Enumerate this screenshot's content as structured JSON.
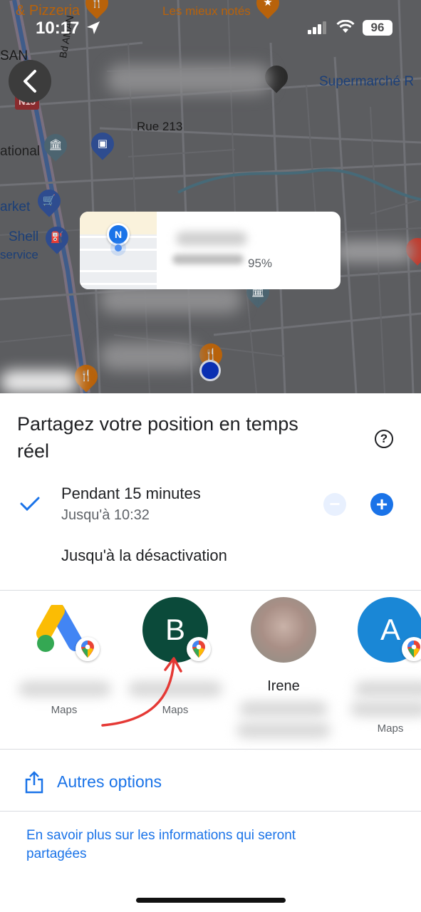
{
  "status_bar": {
    "time": "10:17",
    "battery": "96"
  },
  "map": {
    "labels": {
      "pizzeria": "& Pizzeria",
      "mieux_notes": "Les mieux notés",
      "san": "SAN",
      "bd_aman": "Bd AMAN",
      "n15": "N15",
      "supermarche": "Supermarché R",
      "rue_213": "Rue 213",
      "national": "ational",
      "market": "arket",
      "shell": "Shell",
      "service": "service"
    },
    "info_card": {
      "initial": "N",
      "battery_text": "95%"
    },
    "overlay_color": "#5c5d60",
    "user_dot_color": "#0a2fb2"
  },
  "sheet": {
    "title": "Partagez votre position en temps réel",
    "help_icon": "?",
    "duration_option": {
      "label": "Pendant 15 minutes",
      "sub": "Jusqu'à 10:32",
      "minus": "−",
      "plus": "+"
    },
    "until_off_option": {
      "label": "Jusqu'à la désactivation"
    },
    "contacts": [
      {
        "avatar": "google-ads-logo",
        "name": "",
        "sub": "Maps"
      },
      {
        "avatar": "B",
        "avatar_color": "#0b4a3a",
        "name": "",
        "sub": "Maps"
      },
      {
        "avatar": "photo",
        "name": "Irene",
        "sub": ""
      },
      {
        "avatar": "A",
        "avatar_color": "#1a87d6",
        "name": "",
        "sub": "Maps"
      }
    ],
    "more_options": "Autres options",
    "learn_more": "En savoir plus sur les informations qui seront partagées",
    "accent_color": "#1a73e8",
    "annotation_arrow_color": "#e53935"
  }
}
